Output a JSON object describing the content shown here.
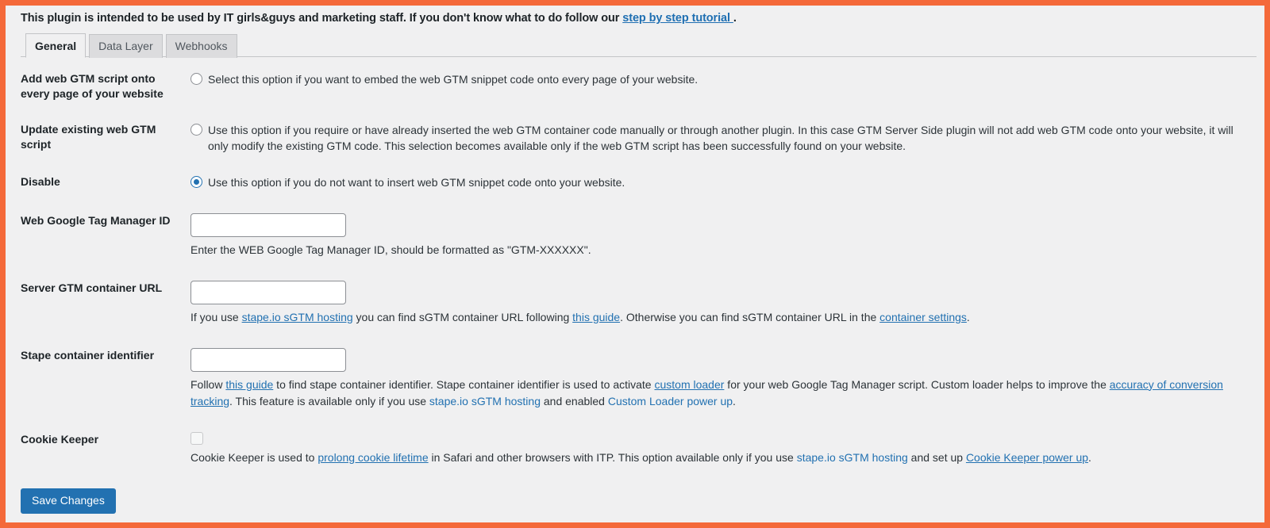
{
  "notice": {
    "text_before": "This plugin is intended to be used by IT girls&guys and marketing staff. If you don't know what to do follow our ",
    "link_label": "step by step tutorial ",
    "text_after": "."
  },
  "tabs": [
    {
      "label": "General",
      "active": true
    },
    {
      "label": "Data Layer",
      "active": false
    },
    {
      "label": "Webhooks",
      "active": false
    }
  ],
  "rows": {
    "add_script": {
      "label": "Add web GTM script onto every page of your website",
      "option_text": "Select this option if you want to embed the web GTM snippet code onto every page of your website.",
      "selected": false
    },
    "update_script": {
      "label": "Update existing web GTM script",
      "option_text": "Use this option if you require or have already inserted the web GTM container code manually or through another plugin. In this case GTM Server Side plugin will not add web GTM code onto your website, it will only modify the existing GTM code. This selection becomes available only if the web GTM script has been successfully found on your website.",
      "selected": false
    },
    "disable": {
      "label": "Disable",
      "option_text": "Use this option if you do not want to insert web GTM snippet code onto your website.",
      "selected": true
    },
    "web_gtm_id": {
      "label": "Web Google Tag Manager ID",
      "value": "",
      "placeholder": "",
      "desc": "Enter the WEB Google Tag Manager ID, should be formatted as \"GTM-XXXXXX\"."
    },
    "server_gtm_url": {
      "label": "Server GTM container URL",
      "value": "",
      "placeholder": "",
      "desc_1": "If you use ",
      "link_1": "stape.io sGTM hosting",
      "desc_2": " you can find sGTM container URL following ",
      "link_2": "this guide",
      "desc_3": ". Otherwise you can find sGTM container URL in the ",
      "link_3": "container settings",
      "desc_4": "."
    },
    "stape_identifier": {
      "label": "Stape container identifier",
      "value": "",
      "placeholder": "",
      "desc_1": "Follow ",
      "link_1": "this guide",
      "desc_2": " to find stape container identifier. Stape container identifier is used to activate ",
      "link_2": "custom loader",
      "desc_3": " for your web Google Tag Manager script. Custom loader helps to improve the ",
      "link_3": "accuracy of conversion tracking",
      "desc_4": ". This feature is available only if you use ",
      "link_4": "stape.io sGTM hosting",
      "desc_5": " and enabled ",
      "link_5": "Custom Loader power up",
      "desc_6": "."
    },
    "cookie_keeper": {
      "label": "Cookie Keeper",
      "checked": false,
      "desc_1": "Cookie Keeper is used to ",
      "link_1": "prolong cookie lifetime",
      "desc_2": " in Safari and other browsers with ITP. This option available only if you use ",
      "link_2": "stape.io sGTM hosting",
      "desc_3": " and set up ",
      "link_3": "Cookie Keeper power up",
      "desc_4": "."
    }
  },
  "submit": {
    "label": "Save Changes"
  },
  "colors": {
    "accent_border": "#f4693a",
    "link": "#2271b1",
    "button": "#2271b1",
    "background": "#f0f0f1"
  }
}
